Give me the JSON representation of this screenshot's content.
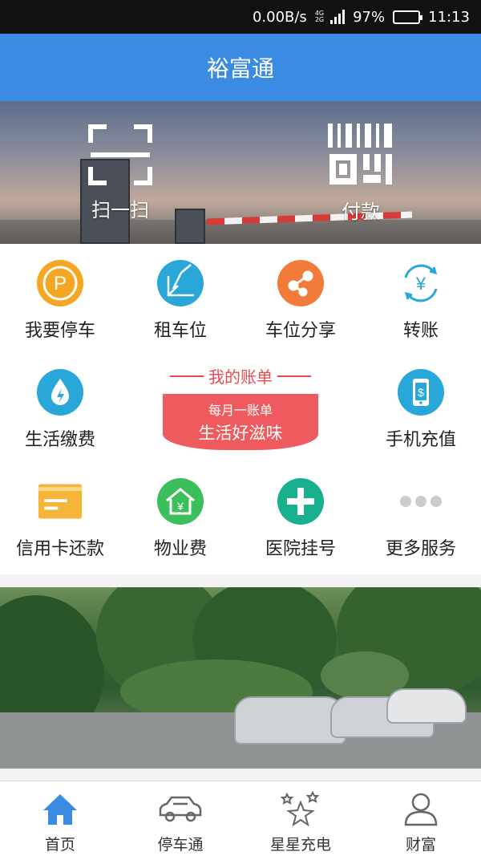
{
  "status_bar": {
    "speed": "0.00B/s",
    "net_top": "4G",
    "net_bottom": "2G",
    "battery": "97%",
    "time": "11:13"
  },
  "header": {
    "title": "裕富通"
  },
  "hero": {
    "scan_label": "扫一扫",
    "pay_label": "付款"
  },
  "services": [
    {
      "label": "我要停车",
      "icon": "parking-icon",
      "color": "#f5a623"
    },
    {
      "label": "租车位",
      "icon": "rent-space-icon",
      "color": "#2aa7d9"
    },
    {
      "label": "车位分享",
      "icon": "share-icon",
      "color": "#f27b3a"
    },
    {
      "label": "转账",
      "icon": "transfer-icon",
      "color": "#2aa7d9"
    },
    {
      "label": "生活缴费",
      "icon": "utility-icon",
      "color": "#2aa7d9"
    },
    {
      "label": "手机充值",
      "icon": "phone-recharge-icon",
      "color": "#2aa7d9"
    },
    {
      "label": "信用卡还款",
      "icon": "credit-card-icon",
      "color": "#f5b53a"
    },
    {
      "label": "物业费",
      "icon": "property-fee-icon",
      "color": "#3bbf5a"
    },
    {
      "label": "医院挂号",
      "icon": "hospital-icon",
      "color": "#18b08f"
    },
    {
      "label": "更多服务",
      "icon": "more-icon",
      "color": "#cccccc"
    }
  ],
  "bill_promo": {
    "title": "我的账单",
    "line1": "每月一账单",
    "line2": "生活好滋味",
    "color": "#ef5a5f"
  },
  "bottom_nav": [
    {
      "label": "首页",
      "icon": "home-icon",
      "active": true
    },
    {
      "label": "停车通",
      "icon": "car-icon",
      "active": false
    },
    {
      "label": "星星充电",
      "icon": "stars-icon",
      "active": false
    },
    {
      "label": "财富",
      "icon": "user-icon",
      "active": false
    }
  ],
  "colors": {
    "primary": "#3b8be3",
    "accent_red": "#ef5a5f"
  }
}
